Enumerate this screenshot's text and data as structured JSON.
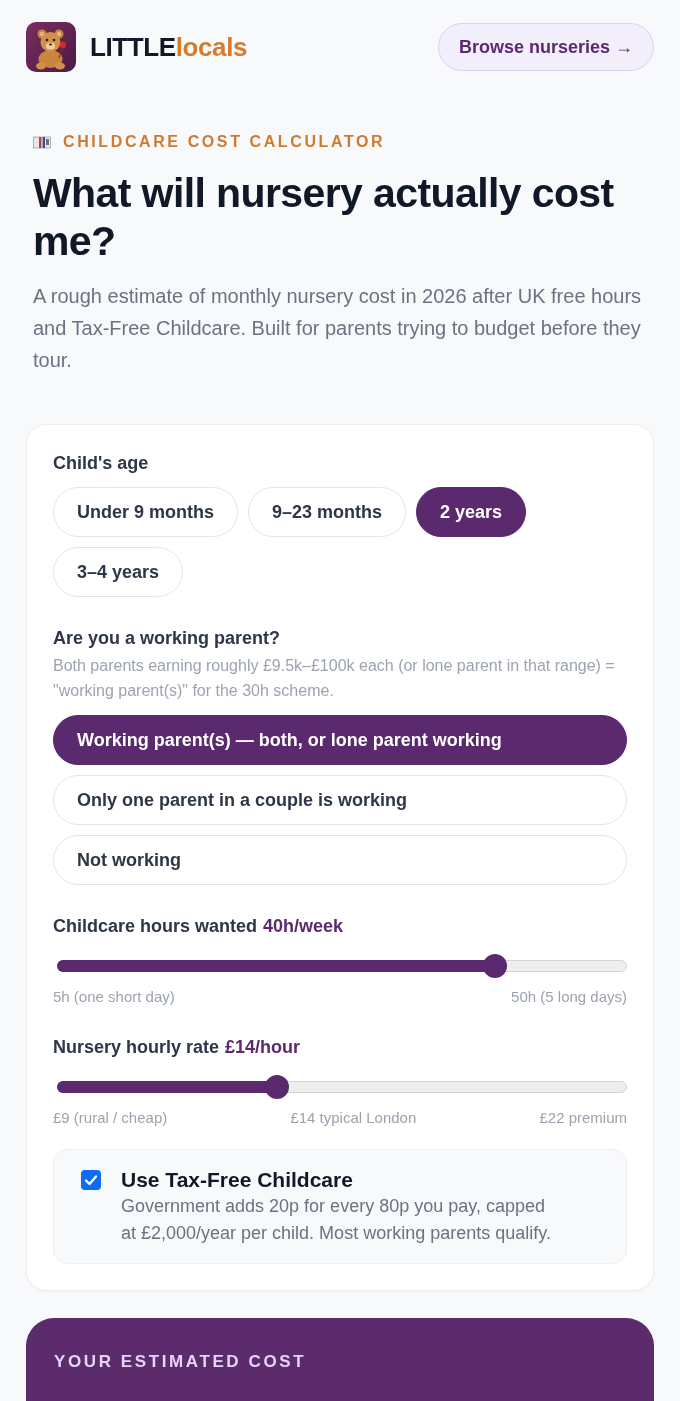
{
  "header": {
    "brand": {
      "first": "LITTLE",
      "second": "locals"
    },
    "button": "Browse nurseries →"
  },
  "hero": {
    "eyebrow": "CHILDCARE COST CALCULATOR",
    "title": "What will nursery actually cost me?",
    "subtitle": "A rough estimate of monthly nursery cost in 2026 after UK free hours and Tax-Free Childcare. Built for parents trying to budget before they tour."
  },
  "form": {
    "age": {
      "label": "Child's age",
      "options": [
        {
          "label": "Under 9 months",
          "selected": false
        },
        {
          "label": "9–23 months",
          "selected": false
        },
        {
          "label": "2 years",
          "selected": true
        },
        {
          "label": "3–4 years",
          "selected": false
        }
      ]
    },
    "working": {
      "label": "Are you a working parent?",
      "hint": "Both parents earning roughly £9.5k–£100k each (or lone parent in that range) = \"working parent(s)\" for the 30h scheme.",
      "options": [
        {
          "label": "Working parent(s) — both, or lone parent working",
          "selected": true
        },
        {
          "label": "Only one parent in a couple is working",
          "selected": false
        },
        {
          "label": "Not working",
          "selected": false
        }
      ]
    },
    "sliders": [
      {
        "label": "Childcare hours wanted",
        "value": "40h/week",
        "level": 0.77,
        "marks": [
          "5h (one short day)",
          "50h (5 long days)"
        ]
      },
      {
        "label": "Nursery hourly rate",
        "value": "£14/hour",
        "level": 0.39,
        "marks": [
          "£9 (rural / cheap)",
          "£14 typical London",
          "£22 premium"
        ]
      }
    ],
    "tax_free": {
      "title": "Use Tax-Free Childcare",
      "description": "Government adds 20p for every 80p you pay, capped at £2,000/year per child. Most working parents qualify.",
      "checked": true
    }
  },
  "result": {
    "heading": "YOUR ESTIMATED COST"
  }
}
